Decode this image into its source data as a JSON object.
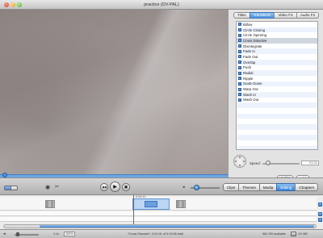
{
  "window": {
    "title": "practice (DV-PAL)"
  },
  "pane": {
    "tabs": [
      {
        "label": "Titles",
        "active": false
      },
      {
        "label": "Transitions",
        "active": true
      },
      {
        "label": "Video FX",
        "active": false
      },
      {
        "label": "Audio FX",
        "active": false
      }
    ],
    "transitions": [
      "Billow",
      "Circle Closing",
      "Circle Opening",
      "Cross Dissolve",
      "Disintegrate",
      "Fade In",
      "Fade Out",
      "Overlap",
      "Push",
      "Radial",
      "Ripple",
      "Scale Down",
      "Warp Out",
      "Wash In",
      "Wash Out"
    ],
    "selected_transition": "Cross Dissolve",
    "speed_label": "Speed:",
    "speed_value": "01:01",
    "update_label": "Update",
    "add_label": "Add"
  },
  "toolbar": {
    "view_a_icon": "clip-view-icon",
    "view_b_icon": "timeline-view-icon",
    "import_icon": "camera-icon",
    "scissor_icon": "scissors-icon",
    "rewind_label": "◀◀",
    "play_label": "▶",
    "fullscreen_label": "▣",
    "volume_level": 0.2,
    "segments": [
      {
        "label": "Clips",
        "active": false
      },
      {
        "label": "Themes",
        "active": false
      },
      {
        "label": "Media",
        "active": false
      },
      {
        "label": "Editing",
        "active": true
      },
      {
        "label": "Chapters",
        "active": false
      }
    ]
  },
  "timeline": {
    "ruler_time": "0:05:10",
    "playhead_level": 0.42
  },
  "status": {
    "zoom_label": "1:1x",
    "zoom_value": "100%",
    "message": "\"Cross Dissolve\": 0:01:01 of 0:10:06 total",
    "disk_free": "981 GB available",
    "disk_size": "1G MB"
  },
  "colors": {
    "accent": "#4e91dd",
    "selection": "#cfd6df"
  }
}
